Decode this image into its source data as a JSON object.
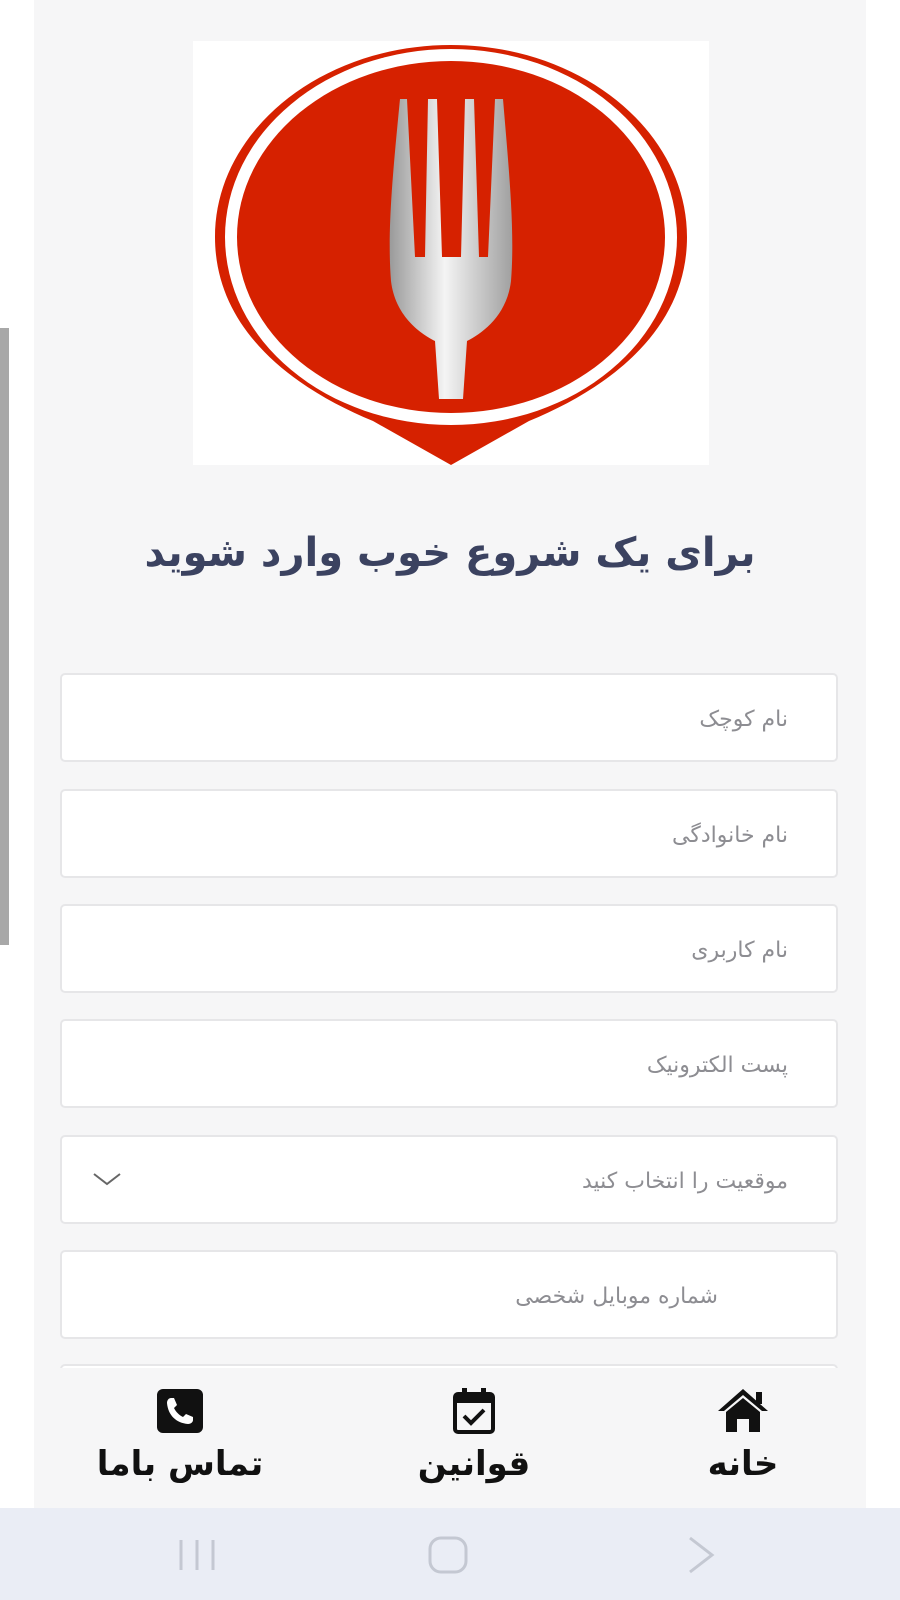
{
  "logo": {
    "name": "fork-logo",
    "colors": {
      "red": "#d62100",
      "silver": "#c9c9c9"
    }
  },
  "headline": "برای یک شروع خوب وارد شوید",
  "form": {
    "first_name_placeholder": "نام کوچک",
    "last_name_placeholder": "نام خانوادگی",
    "username_placeholder": "نام کاربری",
    "email_placeholder": "پست الکترونیک",
    "location_placeholder": "موقعیت را انتخاب کنید",
    "phone_placeholder": "شماره موبایل شخصی"
  },
  "nav": {
    "home_label": "خانه",
    "rules_label": "قوانین",
    "contact_label": "تماس باما",
    "icons": [
      "home-icon",
      "calendar-check-icon",
      "phone-icon"
    ]
  },
  "system_nav": {
    "icons": [
      "recent-apps-icon",
      "home-button-icon",
      "back-icon"
    ]
  },
  "colors": {
    "headline": "#3b4260",
    "placeholder": "#8d8d92",
    "background": "#f6f6f7"
  }
}
